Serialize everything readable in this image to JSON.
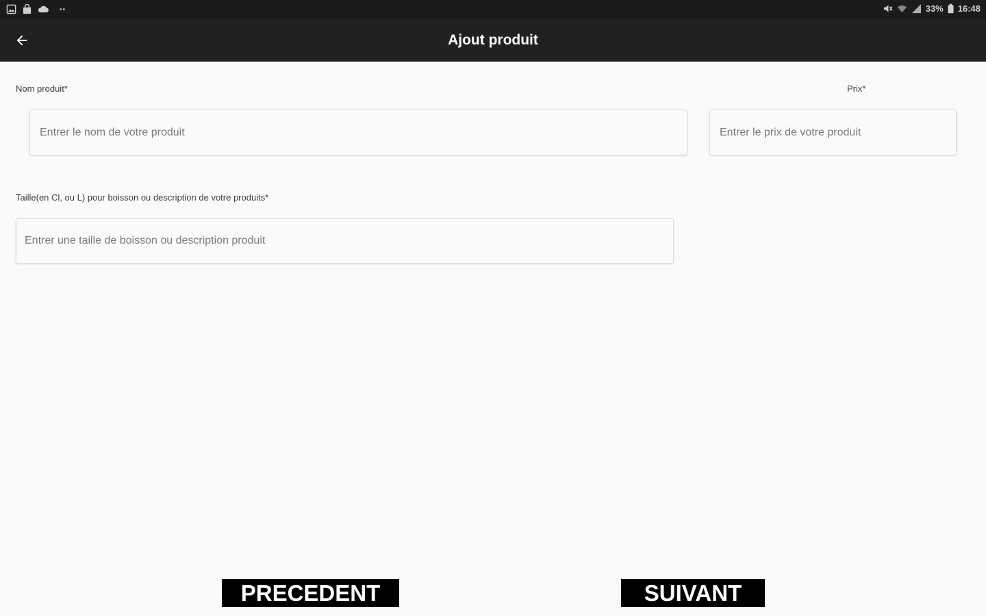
{
  "status_bar": {
    "left_icons": [
      "gallery-icon",
      "bag-icon",
      "cloud-icon",
      "more-dots-icon"
    ],
    "battery_percent": "33%",
    "time": "16:48"
  },
  "app_bar": {
    "title": "Ajout produit",
    "back_icon": "arrow-left-icon"
  },
  "form": {
    "name": {
      "label": "Nom produit*",
      "placeholder": "Entrer le nom de votre produit",
      "value": ""
    },
    "price": {
      "label": "Prix*",
      "placeholder": "Entrer le prix de votre produit",
      "value": ""
    },
    "size": {
      "label": "Taille(en Cl, ou L) pour boisson ou description de votre produits*",
      "placeholder": "Entrer une taille de boisson ou description produit",
      "value": ""
    }
  },
  "buttons": {
    "previous": "PRECEDENT",
    "next": "SUIVANT"
  },
  "colors": {
    "app_bar": "#212121",
    "status_bar": "#1b1b1b",
    "background": "#fafafa",
    "button_bg": "#000000",
    "button_text": "#ffffff"
  }
}
